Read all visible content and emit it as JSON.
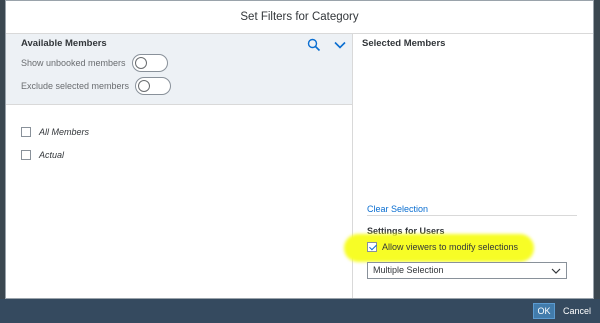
{
  "dialog": {
    "title": "Set Filters for Category"
  },
  "left_pane": {
    "title": "Available Members",
    "toggles": [
      {
        "label": "Show unbooked members",
        "on": false
      },
      {
        "label": "Exclude selected members",
        "on": false
      }
    ],
    "members": [
      {
        "label": "All Members",
        "checked": false
      },
      {
        "label": "Actual",
        "checked": false
      }
    ],
    "icons": {
      "search": "search-icon",
      "expand": "chevron-down-icon"
    }
  },
  "right_pane": {
    "title": "Selected Members",
    "clear_selection": "Clear Selection",
    "settings_title": "Settings for Users",
    "allow_viewers_label": "Allow viewers to modify selections",
    "allow_viewers_checked": true,
    "selection_mode": "Multiple Selection"
  },
  "footer": {
    "ok_label": "OK",
    "cancel_label": "Cancel"
  },
  "colors": {
    "accent": "#0a6ed1",
    "highlight": "#f7fd26",
    "footer_bg": "#354a5f",
    "ok_bg": "#427cac",
    "left_header_bg": "#edf1f5"
  }
}
